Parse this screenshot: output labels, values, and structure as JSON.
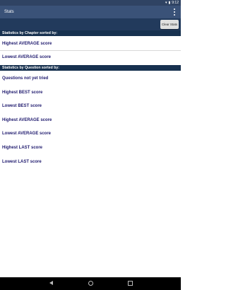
{
  "status": {
    "time": "9:12"
  },
  "app": {
    "title": "Stats"
  },
  "toolbar": {
    "clear_label": "Clear Stats"
  },
  "chapter": {
    "header": "Statistics by Chapter sorted by:",
    "items": [
      "Highest AVERAGE score",
      "Lowest AVERAGE score"
    ]
  },
  "question": {
    "header": "Statistics by Question sorted by:",
    "items": [
      "Questions not yet tried",
      "Highest BEST score",
      "Lowest BEST score",
      "Highest AVERAGE score",
      "Lowest AVERAGE score",
      "Highest LAST score",
      "Lowest LAST score"
    ]
  },
  "colors": {
    "appbar": "#3a5278",
    "header": "#17314f",
    "item_text": "#1f1a6e"
  }
}
